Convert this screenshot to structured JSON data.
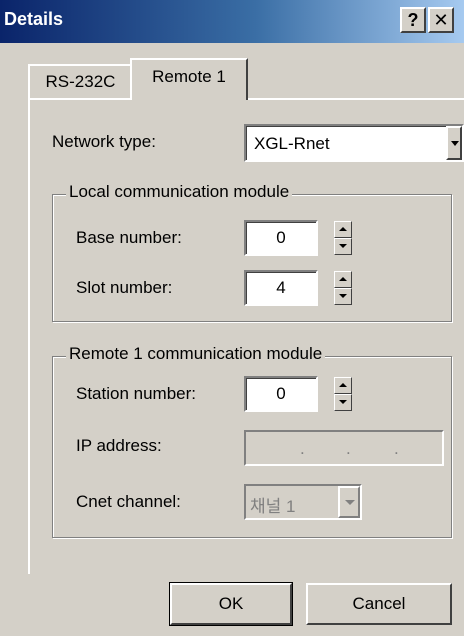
{
  "window": {
    "title": "Details",
    "help_glyph": "?",
    "close_glyph": "✕"
  },
  "tabs": [
    {
      "label": "RS-232C",
      "active": false
    },
    {
      "label": "Remote 1",
      "active": true
    }
  ],
  "network": {
    "label": "Network type:",
    "value": "XGL-Rnet"
  },
  "local_group": {
    "legend": "Local communication module",
    "base_label": "Base number:",
    "base_value": "0",
    "slot_label": "Slot number:",
    "slot_value": "4"
  },
  "remote_group": {
    "legend": "Remote 1 communication module",
    "station_label": "Station number:",
    "station_value": "0",
    "ip_label": "IP address:",
    "ip_dots": [
      ".",
      ".",
      "."
    ],
    "cnet_label": "Cnet channel:",
    "cnet_value": "채널 1"
  },
  "buttons": {
    "ok": "OK",
    "cancel": "Cancel"
  },
  "colors": {
    "face": "#d4d0c8",
    "title_start": "#0a246a",
    "title_end": "#a6caf0",
    "disabled_text": "#808080"
  }
}
